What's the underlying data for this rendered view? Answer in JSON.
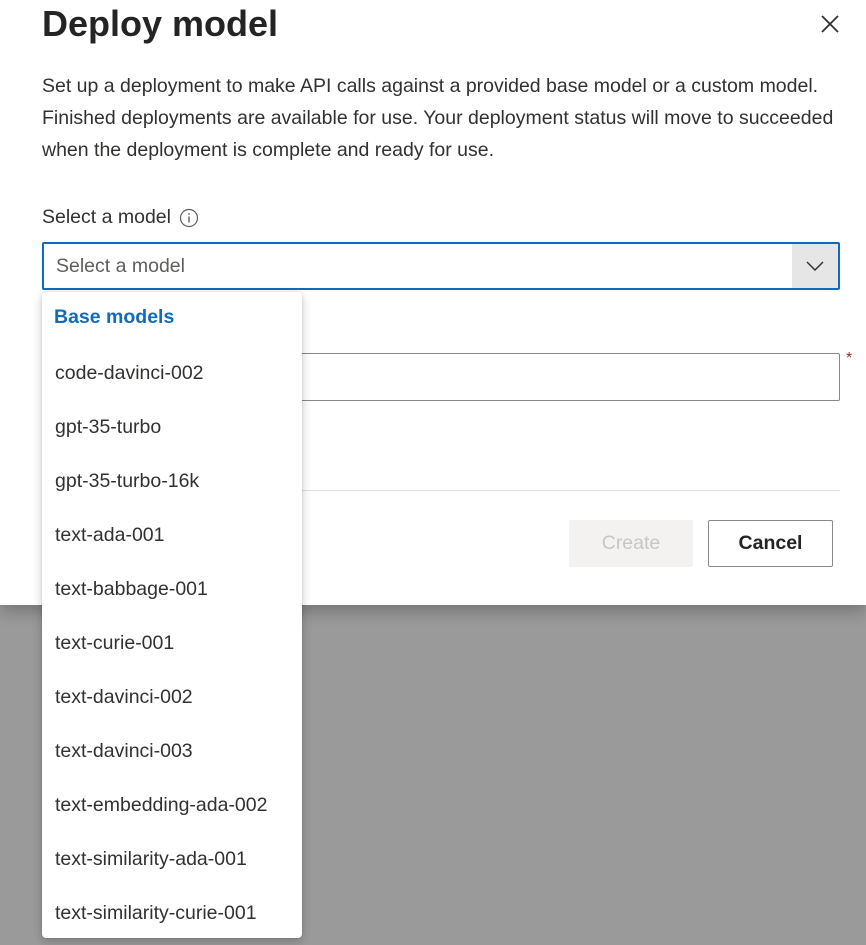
{
  "dialog": {
    "title": "Deploy model",
    "description": "Set up a deployment to make API calls against a provided base model or a custom model. Finished deployments are available for use. Your deployment status will move to succeeded when the deployment is complete and ready for use.",
    "close_icon": "close-icon"
  },
  "model_field": {
    "label": "Select a model",
    "info_icon": "info-icon",
    "placeholder": "Select a model",
    "chevron_icon": "chevron-down-icon"
  },
  "deployment_name_field": {
    "value": "",
    "required": true,
    "required_marker": "*"
  },
  "dropdown": {
    "group_header": "Base models",
    "options": [
      "code-davinci-002",
      "gpt-35-turbo",
      "gpt-35-turbo-16k",
      "text-ada-001",
      "text-babbage-001",
      "text-curie-001",
      "text-davinci-002",
      "text-davinci-003",
      "text-embedding-ada-002",
      "text-similarity-ada-001",
      "text-similarity-curie-001"
    ]
  },
  "footer": {
    "create_label": "Create",
    "cancel_label": "Cancel"
  },
  "colors": {
    "accent": "#0f6cbd",
    "required": "#a4262c",
    "overlay": "#9a9a9a"
  }
}
